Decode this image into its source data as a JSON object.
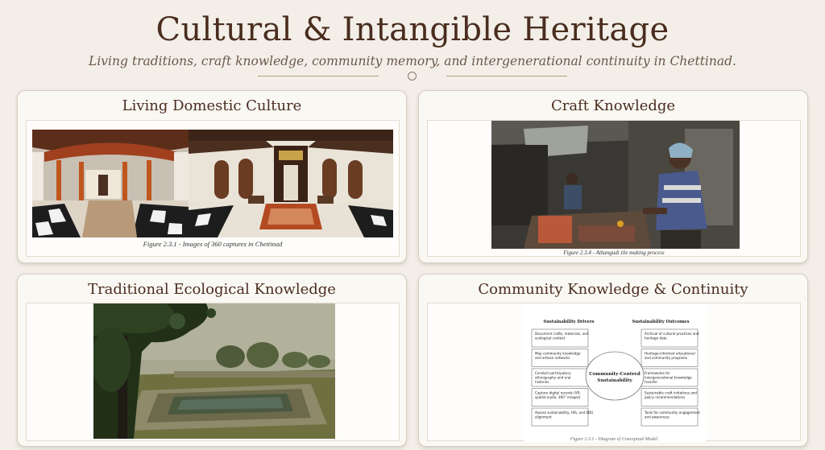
{
  "header": {
    "title": "Cultural & Intangible Heritage",
    "subtitle": "Living traditions, craft knowledge, community memory, and intergenerational continuity in Chettinad."
  },
  "cards": [
    {
      "title": "Living Domestic Culture",
      "caption": "Figure 2.3.1 - Images of 360 captures in Chettinad"
    },
    {
      "title": "Craft Knowledge",
      "caption": "Figure 2.3.4 - Athangudi tile making process"
    },
    {
      "title": "Traditional Ecological Knowledge",
      "caption": ""
    },
    {
      "title": "Community Knowledge & Continuity",
      "caption": "Figure 2.3.1 - Diagram of Conceptual Model"
    }
  ],
  "diagram": {
    "drivers_title": "Sustainability Drivers",
    "outcomes_title": "Sustainability Outcomes",
    "center_line1": "Community-Centred",
    "center_line2": "Sustainability",
    "drivers": [
      [
        "Document crafts, materials, and",
        "ecological context"
      ],
      [
        "Map community knowledge",
        "and artisan networks"
      ],
      [
        "Conduct participatory",
        "ethnography and oral",
        "histories"
      ],
      [
        "Capture digital records (VR,",
        "spatial audio, 360° images)"
      ],
      [
        "Assess sustainability, HIS, and SDG",
        "alignment"
      ]
    ],
    "outcomes": [
      [
        "Archival of cultural practices and",
        "heritage data"
      ],
      [
        "Heritage-informed educational",
        "and community programs"
      ],
      [
        "Frameworks for",
        "intergenerational knowledge",
        "transfer"
      ],
      [
        "Sustainable craft initiatives and",
        "policy recommendations"
      ],
      [
        "Tools for community engagement",
        "and awareness"
      ]
    ]
  },
  "colors": {
    "background": "#f3efe8",
    "title": "#4a2d1f",
    "card": "#faf8f3"
  }
}
